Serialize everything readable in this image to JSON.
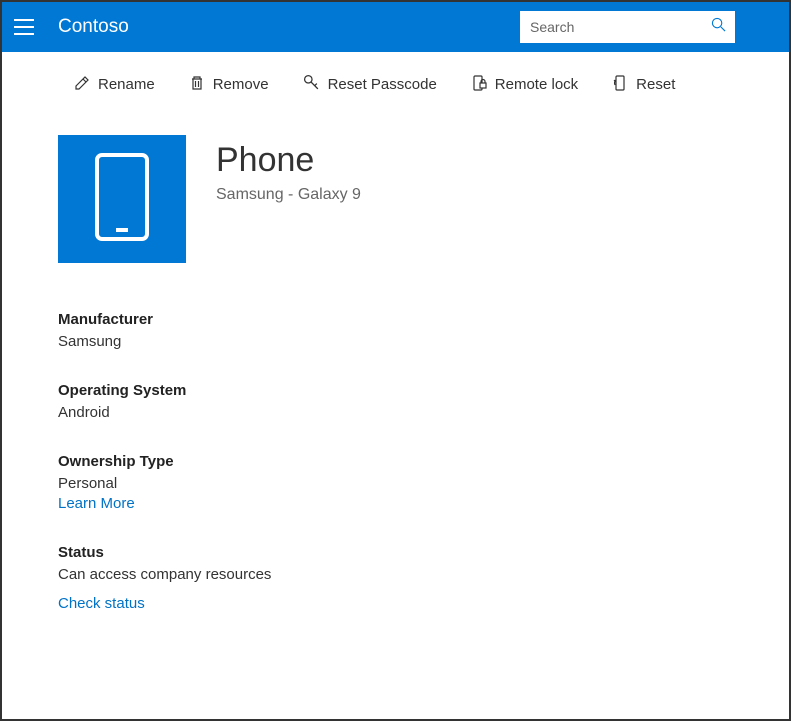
{
  "header": {
    "brand": "Contoso",
    "search_placeholder": "Search"
  },
  "toolbar": {
    "rename": "Rename",
    "remove": "Remove",
    "reset_passcode": "Reset Passcode",
    "remote_lock": "Remote lock",
    "reset": "Reset"
  },
  "device": {
    "name": "Phone",
    "subtitle": "Samsung - Galaxy 9"
  },
  "details": {
    "manufacturer": {
      "label": "Manufacturer",
      "value": "Samsung"
    },
    "os": {
      "label": "Operating System",
      "value": "Android"
    },
    "ownership": {
      "label": "Ownership Type",
      "value": "Personal",
      "link": "Learn More"
    },
    "status": {
      "label": "Status",
      "value": "Can access company resources",
      "link": "Check status"
    }
  }
}
